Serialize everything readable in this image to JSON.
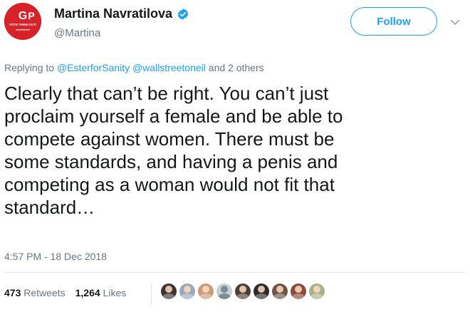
{
  "user": {
    "display_name": "Martina Navratilova",
    "handle": "@Martina",
    "avatar_text": "G P",
    "avatar_subtext": "VOTE THEM OUT!",
    "avatar_color": "#d8222a"
  },
  "follow_button": {
    "label": "Follow"
  },
  "reply": {
    "prefix": "Replying to",
    "users": [
      "@EsterforSanity",
      "@wallstreetoneil"
    ],
    "suffix": "and 2 others"
  },
  "tweet": {
    "lines": [
      "Clearly that can’t be right. You can’t just",
      "proclaim yourself a female and be able to",
      "compete against women. There must be",
      "some standards, and having a penis and",
      "competing as a woman would not fit that",
      "standard…"
    ]
  },
  "timestamp": "4:57 PM - 18 Dec 2018",
  "stats": {
    "retweets_count": "473",
    "retweets_label": "Retweets",
    "likes_count": "1,264",
    "likes_label": "Likes"
  },
  "likers": [
    {
      "color": "#3b3430",
      "name": "liker-avatar"
    },
    {
      "color": "#9aa7b8",
      "name": "liker-avatar"
    },
    {
      "color": "#c89a7a",
      "name": "liker-avatar"
    },
    {
      "color": "#c4cfd6",
      "name": "liker-avatar-default",
      "default": true
    },
    {
      "color": "#4a3f38",
      "name": "liker-avatar"
    },
    {
      "color": "#2c2a28",
      "name": "liker-avatar"
    },
    {
      "color": "#6e5444",
      "name": "liker-avatar"
    },
    {
      "color": "#8a4a3c",
      "name": "liker-avatar"
    },
    {
      "color": "#a8b08a",
      "name": "liker-avatar"
    }
  ],
  "colors": {
    "accent": "#1da1f2",
    "text": "#14171a",
    "muted": "#657786"
  },
  "icons": {
    "verified": "verified-badge-icon",
    "caret": "chevron-down-icon"
  }
}
